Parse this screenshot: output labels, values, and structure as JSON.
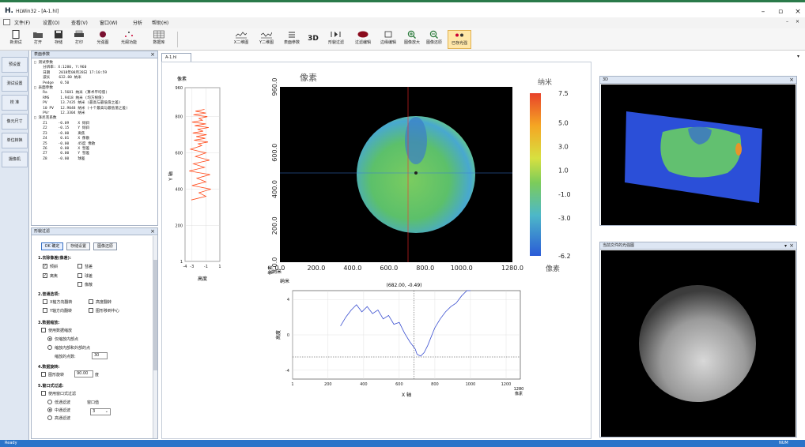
{
  "window": {
    "logo": "H.",
    "title": "HLWin32 - [A-1.hl]",
    "minimize": "–",
    "maximize": "▫",
    "close": "×"
  },
  "menu": [
    "文件(F)",
    "设置(O)",
    "查看(V)",
    "窗口(W)",
    "分析",
    "帮助(H)"
  ],
  "toolbar": [
    {
      "label": "新测试",
      "icon": "new-file-icon"
    },
    {
      "label": "打开",
      "icon": "open-folder-icon"
    },
    {
      "label": "存储",
      "icon": "save-disk-icon"
    },
    {
      "label": "打印",
      "icon": "printer-icon"
    },
    {
      "label": "光强图",
      "icon": "intensity-icon"
    },
    {
      "label": "光阑功能",
      "icon": "aperture-icon"
    },
    {
      "label": "数据库",
      "icon": "database-icon"
    },
    {
      "label": "X二维图",
      "icon": "x-profile-icon"
    },
    {
      "label": "Y二维图",
      "icon": "y-profile-icon"
    },
    {
      "label": "表面参数",
      "icon": "surface-params-icon"
    },
    {
      "label": "3D",
      "icon": "3d-text-icon"
    },
    {
      "label": "形貌过滤",
      "icon": "filter-icon"
    },
    {
      "label": "过滤编辑",
      "icon": "filter-edit-icon"
    },
    {
      "label": "边缘编辑",
      "icon": "edge-edit-icon"
    },
    {
      "label": "图像放大",
      "icon": "zoom-in-icon"
    },
    {
      "label": "图像还原",
      "icon": "zoom-reset-icon"
    },
    {
      "label": "已存光强",
      "icon": "saved-intensity-icon"
    }
  ],
  "left_tabs": [
    "预设置",
    "测试设置",
    "校 准",
    "像元尺寸",
    "单位转换",
    "摄像机"
  ],
  "params_panel": {
    "title": "表面参数",
    "lines": [
      "□ 测试参数",
      "    分辨率: X:1280, Y:960",
      "    日期    2018年08月28日 17:10:59",
      "    波长    632.80 纳米",
      "    Pedge   0.50",
      "□ 表面参数",
      "    Ra      1.5681 纳米 (算术平均值)",
      "    RMS     1.9418 纳米 (均方根值)",
      "    PV      13.7435 纳米 (最高与最低值之差)",
      "    10 PV   12.9048 纳米 (十个最高与最低值之差)",
      "    PVr     12.3304 纳米",
      "□ 泽尼克系数",
      "    Z1     -0.09    X 倾斜",
      "    Z2     -0.15    Y 倾斜",
      "    Z3     -0.00    离焦",
      "    Z4      0.01    X 像散",
      "    Z5     -0.00    45度 像散",
      "    Z6      0.00    X 彗差",
      "    Z7      0.00    Y 彗差",
      "    Z8     -0.00    球差"
    ]
  },
  "filter_panel": {
    "title": "形貌过滤",
    "buttons": {
      "ok": "OK 确定",
      "save": "存储设置",
      "restore": "图像还原"
    },
    "section1": "1.去除像差(像差):",
    "aberrations": [
      {
        "label": "倾斜",
        "checked": true
      },
      {
        "label": "彗差",
        "checked": false
      },
      {
        "label": "离焦",
        "checked": true
      },
      {
        "label": "球差",
        "checked": false
      },
      {
        "label": "像散",
        "checked": false
      }
    ],
    "section2": "2.普通选项:",
    "flips": [
      {
        "label": "X轴方向翻转",
        "checked": false
      },
      {
        "label": "高度翻转",
        "checked": false
      },
      {
        "label": "Y轴方向翻转",
        "checked": false
      },
      {
        "label": "图形移到中心",
        "checked": false
      }
    ],
    "section3": "3.数据缩放:",
    "use_scaling": "使用数据缩放",
    "radios3": [
      {
        "label": "仅缩放内部点",
        "on": true
      },
      {
        "label": "缩放内部和外部的点",
        "on": false
      }
    ],
    "scale_label": "缩放的点数:",
    "scale_value": "30",
    "section4": "4.数据旋转:",
    "rotate_label": "图形旋转",
    "rotate_value": "90.00",
    "rotate_unit": "度",
    "section5": "5.窗口式过滤:",
    "use_window": "使用窗口式过滤",
    "radios5": [
      {
        "label": "低通滤波",
        "on": false
      },
      {
        "label": "中通滤波",
        "on": true
      },
      {
        "label": "高通滤波",
        "on": false
      }
    ],
    "window_label": "窗口值",
    "window_value": "3"
  },
  "doc_tab": "A-1.hl",
  "map": {
    "title": "像素",
    "xlabel": "像素",
    "ylabel": "像素",
    "colorbar_title": "纳米",
    "colorbar_ticks": [
      "7.5",
      "5.0",
      "3.0",
      "1.0",
      "-1.0",
      "-3.0",
      "-6.2"
    ],
    "x_ticks": [
      "0.0",
      "200.0",
      "400.0",
      "600.0",
      "800.0",
      "1000.0",
      "1280.0"
    ],
    "y_ticks": [
      "0.0",
      "200.0",
      "400.0",
      "600.0",
      "960.0"
    ]
  },
  "y_profile": {
    "top_label": "像素",
    "ylabel": "Y 轴",
    "xlabel": "高度",
    "unit": "纳米",
    "y_ticks": [
      "960",
      "800",
      "600",
      "400",
      "200",
      "1"
    ],
    "x_ticks": [
      "-4",
      "-3",
      "-1",
      "1"
    ]
  },
  "x_profile": {
    "unit_label": "纳米",
    "coord": "(682.00, -0.49)",
    "ylabel": "高度",
    "xlabel": "X 轴",
    "x_ticks": [
      "1",
      "200",
      "400",
      "600",
      "800",
      "1000",
      "1200"
    ],
    "last_tick": "1280",
    "pixel_label": "像素",
    "y_ticks": [
      "4",
      "0",
      "-4"
    ]
  },
  "view3d": {
    "title": "3D"
  },
  "viewlight": {
    "title": "当前文件的光强图"
  },
  "status": {
    "ready": "Ready",
    "num": "NUM"
  },
  "colors": {
    "accent": "#2b74c9",
    "panel_title": "#dde6f3",
    "profile_red": "#ff4a1a",
    "profile_blue": "#3a4fd0"
  },
  "chart_data": [
    {
      "type": "line",
      "title": "",
      "xlabel": "高度",
      "ylabel": "Y 轴",
      "xlim": [
        -4,
        1
      ],
      "ylim": [
        1,
        960
      ],
      "series": [
        {
          "x": [
            -1.2,
            -2.5,
            -1.0,
            -2.8,
            -0.8,
            -2.0,
            -1.5,
            -3.0,
            -1.0,
            -2.6,
            -0.6,
            -2.2,
            -1.4,
            -2.9,
            -0.9,
            -2.4,
            -1.1,
            -2.7,
            -0.7,
            -2.1,
            -1.6,
            -3.2,
            -1.0,
            -2.5,
            -0.5,
            -2.8,
            -1.2,
            -3.4,
            -0.4,
            -2.3,
            -1.0,
            -3.0,
            -0.3,
            -2.0,
            -1.0,
            -3.1
          ],
          "y": [
            840,
            830,
            820,
            810,
            800,
            790,
            780,
            770,
            760,
            750,
            740,
            730,
            720,
            710,
            700,
            690,
            680,
            670,
            660,
            650,
            640,
            620,
            600,
            580,
            560,
            540,
            520,
            500,
            480,
            460,
            440,
            420,
            400,
            380,
            360,
            340
          ]
        }
      ]
    },
    {
      "type": "line",
      "title": "",
      "xlabel": "X 轴",
      "ylabel": "高度",
      "xlim": [
        1,
        1280
      ],
      "ylim": [
        -5,
        5
      ],
      "series": [
        {
          "x": [
            270,
            300,
            330,
            360,
            390,
            420,
            450,
            480,
            510,
            540,
            570,
            600,
            630,
            660,
            690,
            700,
            720,
            740,
            760,
            780,
            800,
            830,
            860,
            890,
            920,
            950,
            980,
            1000
          ],
          "y": [
            1.0,
            2.0,
            2.8,
            3.4,
            2.6,
            3.2,
            2.4,
            2.8,
            1.8,
            2.2,
            1.2,
            1.4,
            0.2,
            -0.8,
            -1.6,
            -2.2,
            -2.4,
            -2.0,
            -1.2,
            -0.2,
            0.8,
            1.8,
            2.6,
            3.2,
            3.6,
            4.4,
            5.0,
            5.0
          ]
        }
      ]
    }
  ]
}
